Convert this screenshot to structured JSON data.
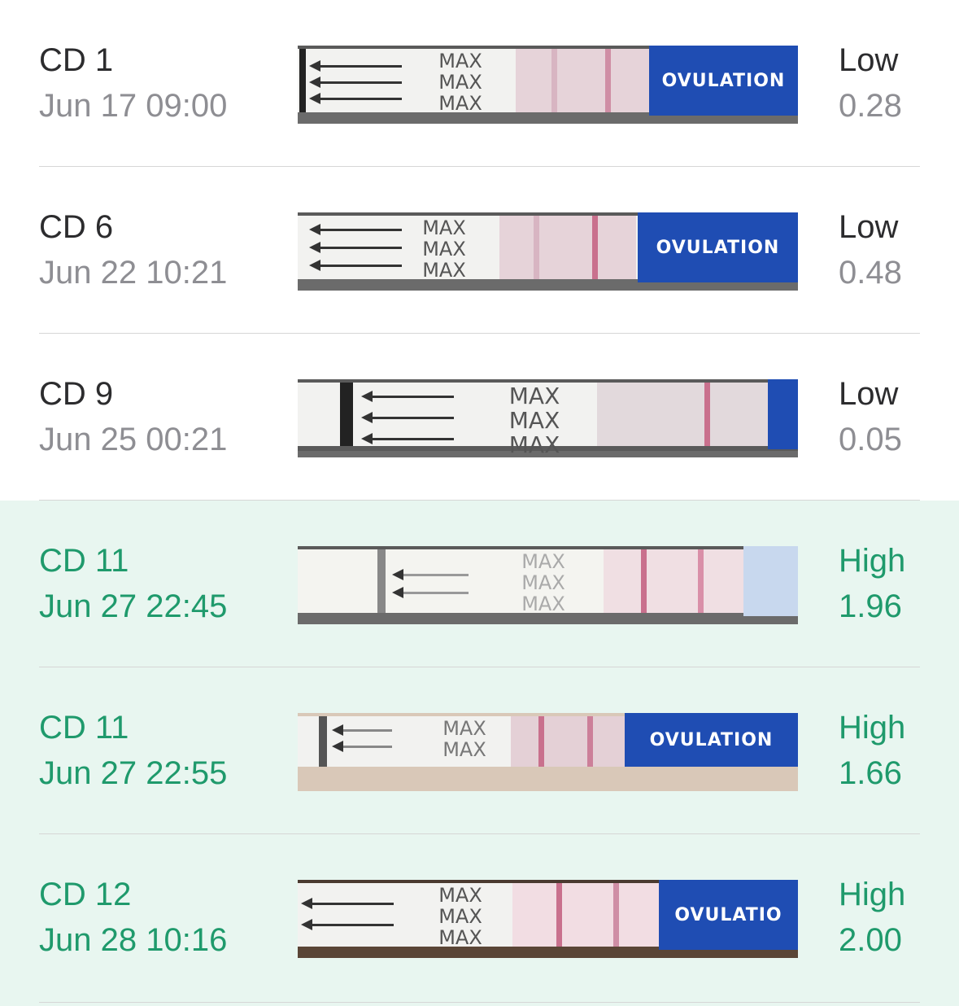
{
  "rows": [
    {
      "cd": "CD 1",
      "date": "Jun 17 09:00",
      "level": "Low",
      "value": "0.28",
      "high": false,
      "brand": "OVULATION"
    },
    {
      "cd": "CD 6",
      "date": "Jun 22 10:21",
      "level": "Low",
      "value": "0.48",
      "high": false,
      "brand": "OVULATION"
    },
    {
      "cd": "CD 9",
      "date": "Jun 25 00:21",
      "level": "Low",
      "value": "0.05",
      "high": false,
      "brand": ""
    },
    {
      "cd": "CD 11",
      "date": "Jun 27 22:45",
      "level": "High",
      "value": "1.96",
      "high": true,
      "brand": ""
    },
    {
      "cd": "CD 11",
      "date": "Jun 27 22:55",
      "level": "High",
      "value": "1.66",
      "high": true,
      "brand": "OVULATION"
    },
    {
      "cd": "CD 12",
      "date": "Jun 28 10:16",
      "level": "High",
      "value": "2.00",
      "high": true,
      "brand": "OVULATIO"
    }
  ],
  "strip_text": {
    "max": "MAX"
  },
  "colors": {
    "high_bg": "#e8f6f0",
    "high_text": "#1f9a6c",
    "low_text": "#2c2c2e",
    "muted": "#8e8e93",
    "accent_blue": "#1f4db3"
  }
}
